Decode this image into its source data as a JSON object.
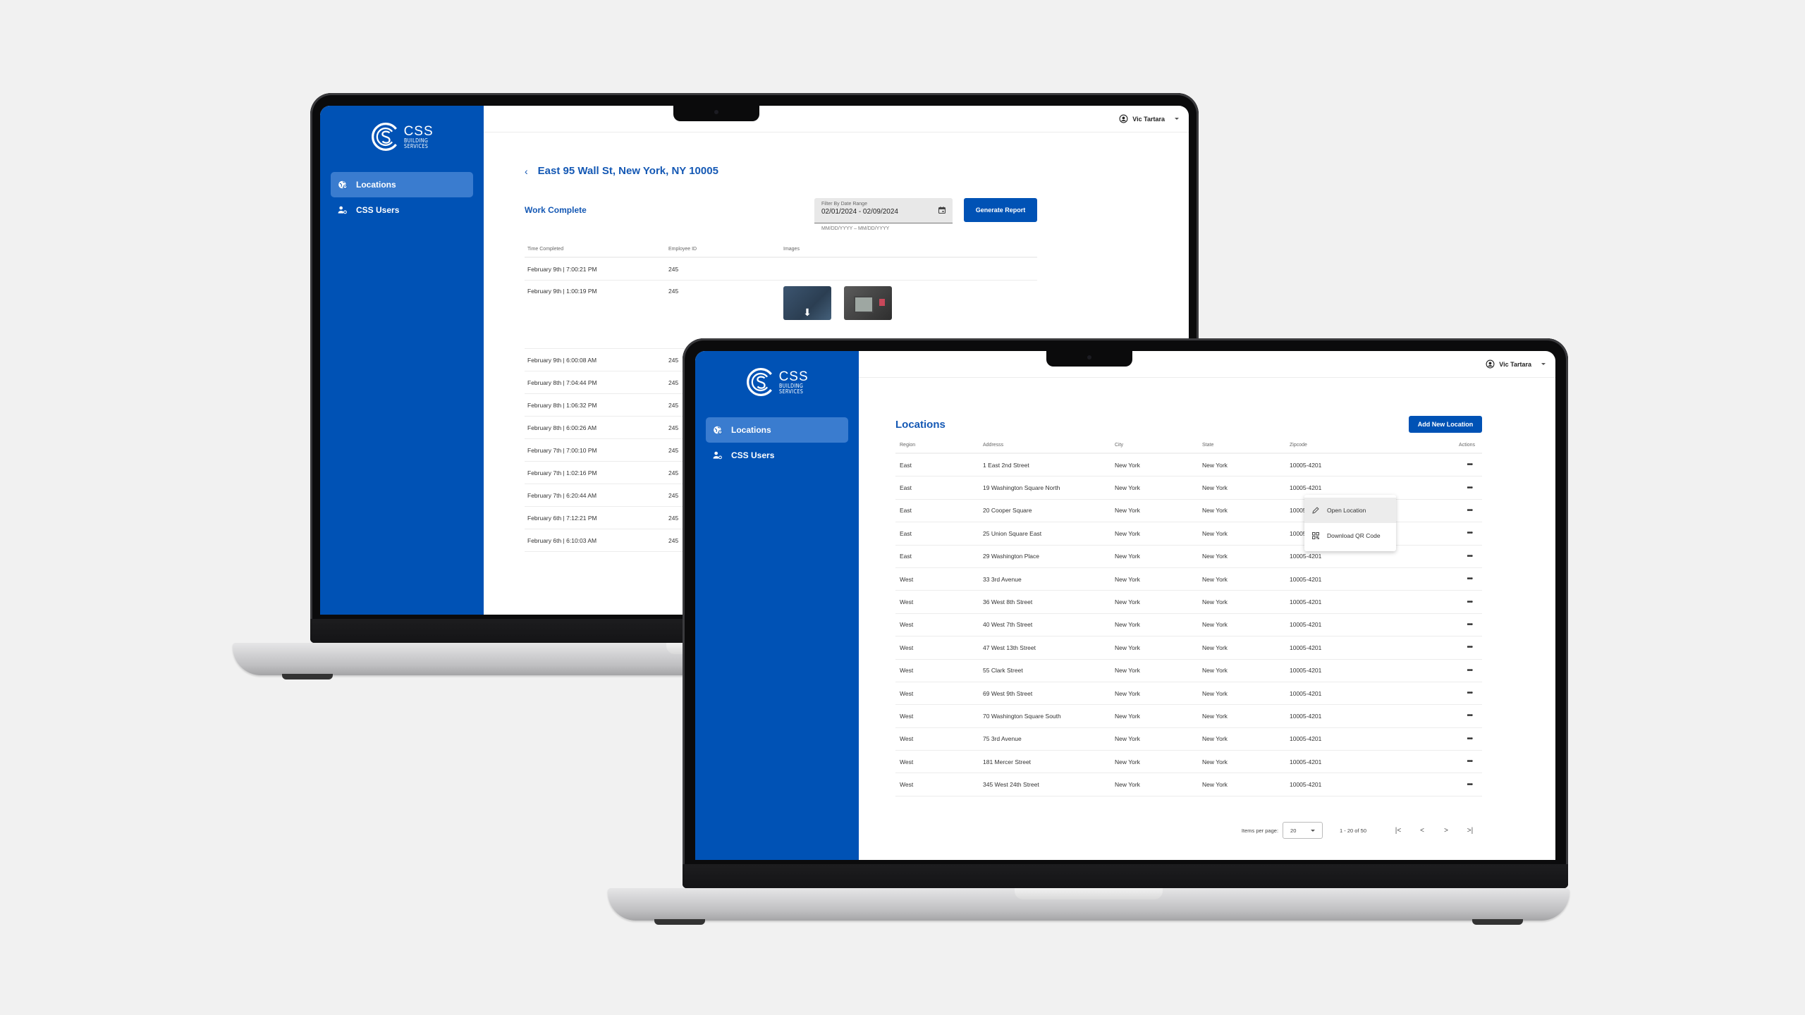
{
  "brand": {
    "name": "CSS",
    "subline1": "BUILDING",
    "subline2": "SERVICES",
    "primary_color": "#0052b5",
    "accent_text_color": "#1458b4"
  },
  "sidebar": {
    "items": [
      {
        "label": "Locations",
        "icon": "globe-pin-icon",
        "active": true
      },
      {
        "label": "CSS Users",
        "icon": "users-gear-icon",
        "active": false
      }
    ]
  },
  "user": {
    "name": "Vic Tartara",
    "icon": "account-circle-icon"
  },
  "detail_screen": {
    "title": "East 95 Wall St, New York, NY 10005",
    "section_title": "Work Complete",
    "date_filter": {
      "label": "Filter By Date Range",
      "value": "02/01/2024 - 02/09/2024",
      "hint": "MM/DD/YYYY – MM/DD/YYYY"
    },
    "generate_button": "Generate Report",
    "columns": [
      "Time Completed",
      "Employee ID",
      "Images"
    ],
    "rows": [
      {
        "time": "February 9th | 7:00:21 PM",
        "employee_id": "245",
        "images": 0
      },
      {
        "time": "February 9th | 1:00:19 PM",
        "employee_id": "245",
        "images": 2
      },
      {
        "time": "February 9th | 6:00:08 AM",
        "employee_id": "245",
        "images": 0
      },
      {
        "time": "February 8th | 7:04:44 PM",
        "employee_id": "245",
        "images": 0
      },
      {
        "time": "February 8th | 1:06:32 PM",
        "employee_id": "245",
        "images": 0
      },
      {
        "time": "February 8th | 6:00:26 AM",
        "employee_id": "245",
        "images": 0
      },
      {
        "time": "February 7th | 7:00:10 PM",
        "employee_id": "245",
        "images": 0
      },
      {
        "time": "February 7th | 1:02:16 PM",
        "employee_id": "245",
        "images": 0
      },
      {
        "time": "February 7th | 6:20:44 AM",
        "employee_id": "245",
        "images": 0
      },
      {
        "time": "February 6th | 7:12:21 PM",
        "employee_id": "245",
        "images": 0
      },
      {
        "time": "February 6th | 6:10:03 AM",
        "employee_id": "245",
        "images": 0
      }
    ]
  },
  "locations_screen": {
    "title": "Locations",
    "add_button": "Add New Location",
    "columns": [
      "Region",
      "Addresss",
      "City",
      "State",
      "Zipcode",
      "Actions"
    ],
    "rows": [
      {
        "region": "East",
        "address": "1 East 2nd Street",
        "city": "New York",
        "state": "New York",
        "zip": "10005-4201"
      },
      {
        "region": "East",
        "address": "19 Washington Square North",
        "city": "New York",
        "state": "New York",
        "zip": "10005-4201"
      },
      {
        "region": "East",
        "address": "20 Cooper Square",
        "city": "New York",
        "state": "New York",
        "zip": "10005-4201"
      },
      {
        "region": "East",
        "address": "25 Union Square East",
        "city": "New York",
        "state": "New York",
        "zip": "10005-4201"
      },
      {
        "region": "East",
        "address": "29 Washington Place",
        "city": "New York",
        "state": "New York",
        "zip": "10005-4201"
      },
      {
        "region": "West",
        "address": "33 3rd Avenue",
        "city": "New York",
        "state": "New York",
        "zip": "10005-4201"
      },
      {
        "region": "West",
        "address": "36 West 8th Street",
        "city": "New York",
        "state": "New York",
        "zip": "10005-4201"
      },
      {
        "region": "West",
        "address": "40 West 7th Street",
        "city": "New York",
        "state": "New York",
        "zip": "10005-4201"
      },
      {
        "region": "West",
        "address": "47 West 13th Street",
        "city": "New York",
        "state": "New York",
        "zip": "10005-4201"
      },
      {
        "region": "West",
        "address": "55 Clark Street",
        "city": "New York",
        "state": "New York",
        "zip": "10005-4201"
      },
      {
        "region": "West",
        "address": "69 West 9th Street",
        "city": "New York",
        "state": "New York",
        "zip": "10005-4201"
      },
      {
        "region": "West",
        "address": "70 Washington Square South",
        "city": "New York",
        "state": "New York",
        "zip": "10005-4201"
      },
      {
        "region": "West",
        "address": "75 3rd Avenue",
        "city": "New York",
        "state": "New York",
        "zip": "10005-4201"
      },
      {
        "region": "West",
        "address": "181 Mercer Street",
        "city": "New York",
        "state": "New York",
        "zip": "10005-4201"
      },
      {
        "region": "West",
        "address": "345 West 24th Street",
        "city": "New York",
        "state": "New York",
        "zip": "10005-4201"
      }
    ],
    "actions_glyph": "•••",
    "context_menu": {
      "open_for_row": 0,
      "items": [
        {
          "label": "Open Location",
          "icon": "pencil-icon"
        },
        {
          "label": "Download QR Code",
          "icon": "qr-code-icon"
        }
      ]
    },
    "pagination": {
      "items_per_page_label": "Items per page:",
      "items_per_page": "20",
      "range": "1 - 20 of 50",
      "first": "|<",
      "prev": "<",
      "next": ">",
      "last": ">|"
    }
  }
}
